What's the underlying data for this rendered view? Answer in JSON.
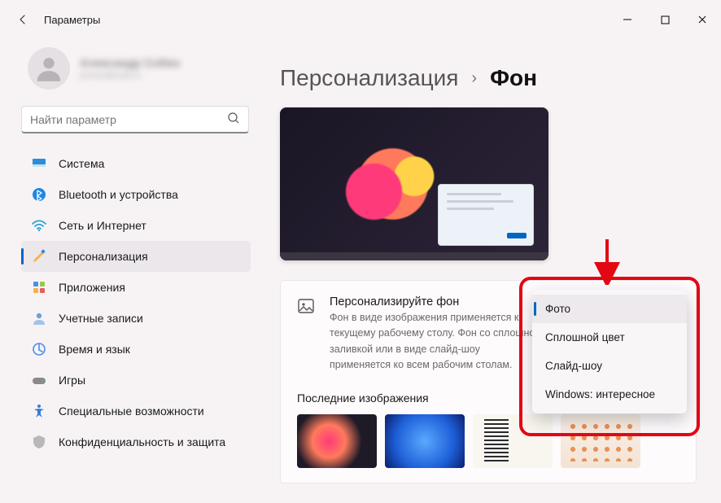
{
  "app": {
    "title": "Параметры"
  },
  "profile": {
    "name": "Александр Собин",
    "email": "primer@mail.ru"
  },
  "search": {
    "placeholder": "Найти параметр"
  },
  "sidebar": {
    "items": [
      {
        "label": "Система"
      },
      {
        "label": "Bluetooth и устройства"
      },
      {
        "label": "Сеть и Интернет"
      },
      {
        "label": "Персонализация"
      },
      {
        "label": "Приложения"
      },
      {
        "label": "Учетные записи"
      },
      {
        "label": "Время и язык"
      },
      {
        "label": "Игры"
      },
      {
        "label": "Специальные возможности"
      },
      {
        "label": "Конфиденциальность и защита"
      }
    ],
    "active_index": 3
  },
  "breadcrumb": {
    "crumb": "Персонализация",
    "current": "Фон"
  },
  "card": {
    "title": "Персонализируйте фон",
    "desc": "Фон в виде изображения применяется к текущему рабочему столу. Фон со сплошной заливкой или в виде слайд-шоу применяется ко всем рабочим столам."
  },
  "recent": {
    "label": "Последние изображения"
  },
  "dropdown": {
    "options": [
      {
        "label": "Фото",
        "selected": true
      },
      {
        "label": "Сплошной цвет",
        "selected": false
      },
      {
        "label": "Слайд-шоу",
        "selected": false
      },
      {
        "label": "Windows: интересное",
        "selected": false
      }
    ]
  }
}
